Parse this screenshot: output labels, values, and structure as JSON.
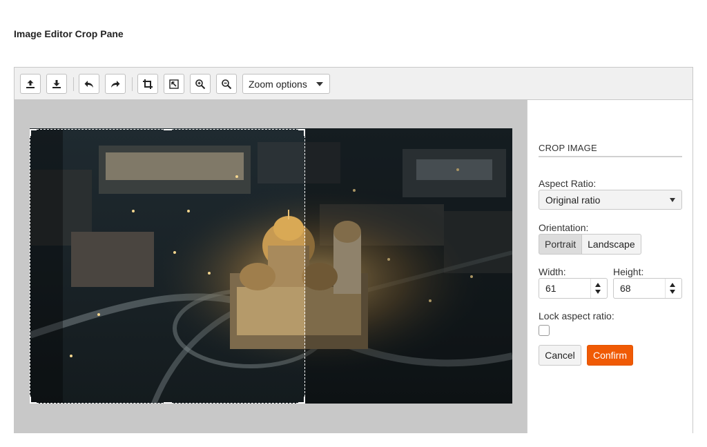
{
  "page": {
    "title": "Image Editor Crop Pane"
  },
  "toolbar": {
    "buttons": [
      {
        "icon": "upload-icon"
      },
      {
        "icon": "download-icon"
      },
      {
        "icon": "undo-icon"
      },
      {
        "icon": "redo-icon"
      },
      {
        "icon": "crop-icon"
      },
      {
        "icon": "transform-icon"
      },
      {
        "icon": "zoom-in-icon"
      },
      {
        "icon": "zoom-out-icon"
      }
    ],
    "zoom_dropdown_label": "Zoom options"
  },
  "crop_panel": {
    "title": "CROP IMAGE",
    "aspect_ratio_label": "Aspect Ratio:",
    "aspect_ratio_value": "Original ratio",
    "orientation_label": "Orientation:",
    "orientation_options": [
      "Portrait",
      "Landscape"
    ],
    "orientation_selected": "Portrait",
    "width_label": "Width:",
    "width_value": "61",
    "height_label": "Height:",
    "height_value": "68",
    "lock_label": "Lock aspect ratio:",
    "lock_checked": false,
    "cancel_label": "Cancel",
    "confirm_label": "Confirm"
  },
  "colors": {
    "accent": "#f05a05",
    "canvas_bg": "#c8c8c8",
    "toolbar_bg": "#f0f0f0"
  }
}
